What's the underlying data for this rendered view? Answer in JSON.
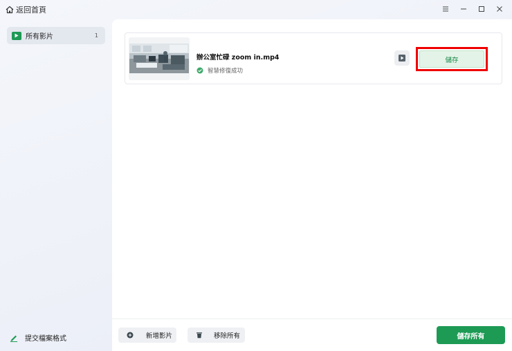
{
  "titlebar": {
    "home_label": "返回首頁",
    "icons": [
      "home-icon",
      "menu-icon",
      "minimize-icon",
      "maximize-icon",
      "close-icon"
    ]
  },
  "sidebar": {
    "items": [
      {
        "label": "所有影片",
        "count": "1",
        "icon": "video-play-icon",
        "active": true
      }
    ],
    "submit_format_label": "提交檔案格式"
  },
  "file_list": [
    {
      "file_name": "辦公室忙碌 zoom in.mp4",
      "status_text": "智慧修復成功",
      "status_icon": "check-circle-icon",
      "save_label": "儲存"
    }
  ],
  "bottom_bar": {
    "add_label": "新增影片",
    "remove_label": "移除所有",
    "save_all_label": "儲存所有"
  },
  "colors": {
    "accent": "#1d9a54",
    "highlight_box": "#f00000",
    "save_btn_bg": "#e4f3e8"
  }
}
